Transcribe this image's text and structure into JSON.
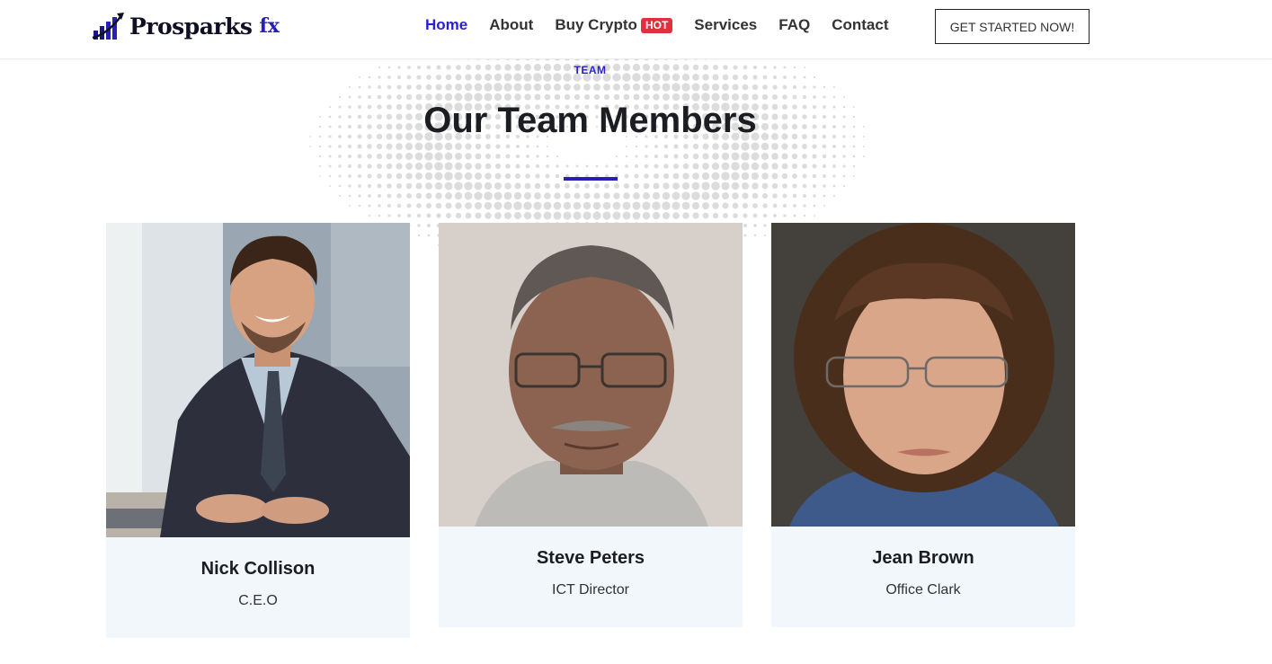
{
  "brand": {
    "name": "Prosparks",
    "suffix": "fx",
    "accent_color": "#2a1fd0",
    "logo_icon": "bar-chart-swoosh-icon"
  },
  "nav": {
    "items": [
      {
        "label": "Home",
        "active": true
      },
      {
        "label": "About",
        "active": false
      },
      {
        "label": "Buy Crypto",
        "active": false,
        "badge": "HOT"
      },
      {
        "label": "Services",
        "active": false
      },
      {
        "label": "FAQ",
        "active": false
      },
      {
        "label": "Contact",
        "active": false
      }
    ],
    "cta_label": "GET STARTED NOW!"
  },
  "section": {
    "eyebrow": "TEAM",
    "title": "Our Team Members"
  },
  "team": [
    {
      "name": "Nick Collison",
      "role": "C.E.O",
      "photo": "smiling-man-in-suit-photo"
    },
    {
      "name": "Steve Peters",
      "role": "ICT Director",
      "photo": "man-with-glasses-photo"
    },
    {
      "name": "Jean Brown",
      "role": "Office Clark",
      "photo": "woman-with-glasses-photo"
    }
  ],
  "colors": {
    "hot_badge": "#e0303e",
    "card_info_bg": "#f2f7fb",
    "underline": "#2a1fb5"
  }
}
